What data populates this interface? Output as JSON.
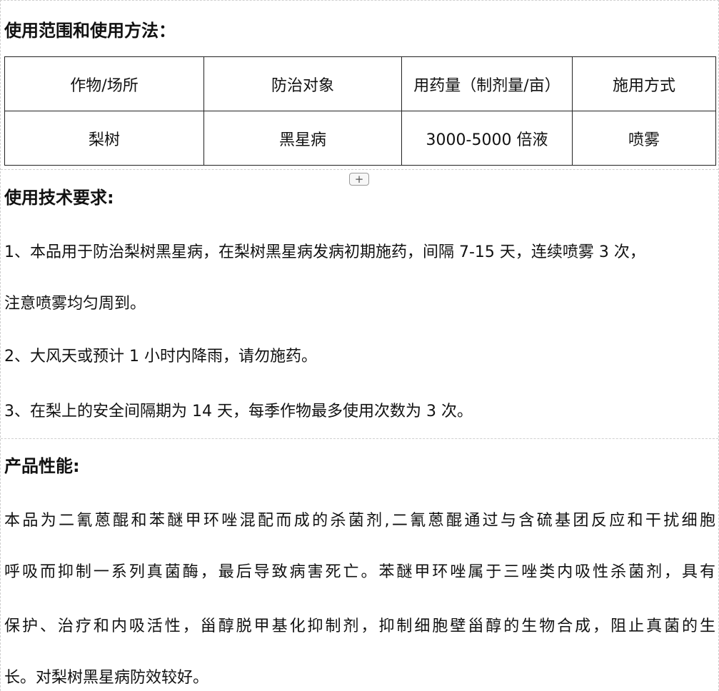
{
  "usage_section": {
    "heading": "使用范围和使用方法：",
    "table": {
      "headers": [
        "作物/场所",
        "防治对象",
        "用药量（制剂量/亩）",
        "施用方式"
      ],
      "rows": [
        [
          "梨树",
          "黑星病",
          "3000-5000 倍液",
          "喷雾"
        ]
      ]
    },
    "add_button_label": "+"
  },
  "tech_section": {
    "heading": "使用技术要求:",
    "lines": [
      "1、本品用于防治梨树黑星病，在梨树黑星病发病初期施药，间隔 7-15 天，连续喷雾 3 次，",
      "注意喷雾均匀周到。",
      "2、大风天或预计 1 小时内降雨，请勿施药。",
      "3、在梨上的安全间隔期为 14 天，每季作物最多使用次数为 3 次。"
    ]
  },
  "performance_section": {
    "heading": "产品性能:",
    "lines": [
      "本品为二氰蒽醌和苯醚甲环唑混配而成的杀菌剂,二氰蒽醌通过与含硫基团反应和干扰细胞",
      "呼吸而抑制一系列真菌酶，最后导致病害死亡。苯醚甲环唑属于三唑类内吸性杀菌剂，具有",
      "保护、治疗和内吸活性，甾醇脱甲基化抑制剂，抑制细胞壁甾醇的生物合成，阻止真菌的生",
      "长。对梨树黑星病防效较好。"
    ]
  }
}
